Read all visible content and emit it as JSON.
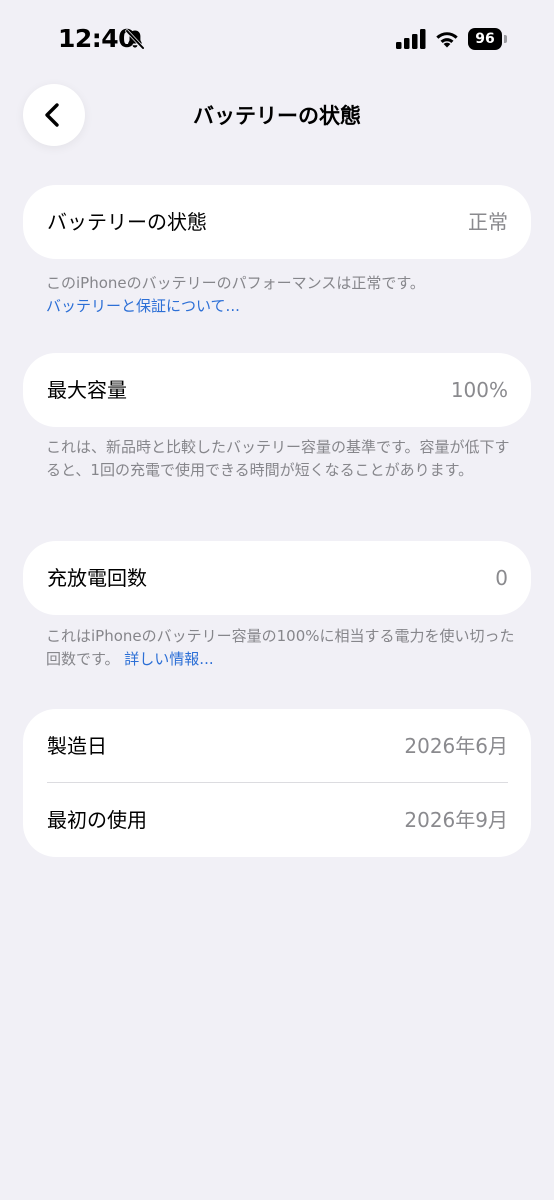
{
  "status_bar": {
    "time": "12:40",
    "battery_level": "96"
  },
  "nav": {
    "title": "バッテリーの状態"
  },
  "health": {
    "label": "バッテリーの状態",
    "value": "正常",
    "footnote": "このiPhoneのバッテリーのパフォーマンスは正常です。",
    "link": "バッテリーと保証について..."
  },
  "capacity": {
    "label": "最大容量",
    "value": "100%",
    "footnote": "これは、新品時と比較したバッテリー容量の基準です。容量が低下すると、1回の充電で使用できる時間が短くなることがあります。"
  },
  "cycles": {
    "label": "充放電回数",
    "value": "0",
    "footnote": "これはiPhoneのバッテリー容量の100%に相当する電力を使い切った回数です。",
    "link": "詳しい情報..."
  },
  "dates": {
    "manufacture_label": "製造日",
    "manufacture_value": "2026年6月",
    "first_use_label": "最初の使用",
    "first_use_value": "2026年9月"
  },
  "colors": {
    "background": "#F1F0F6",
    "card": "#FFFFFF",
    "secondary_text": "#8A8A8E",
    "link": "#2C6FD6"
  }
}
